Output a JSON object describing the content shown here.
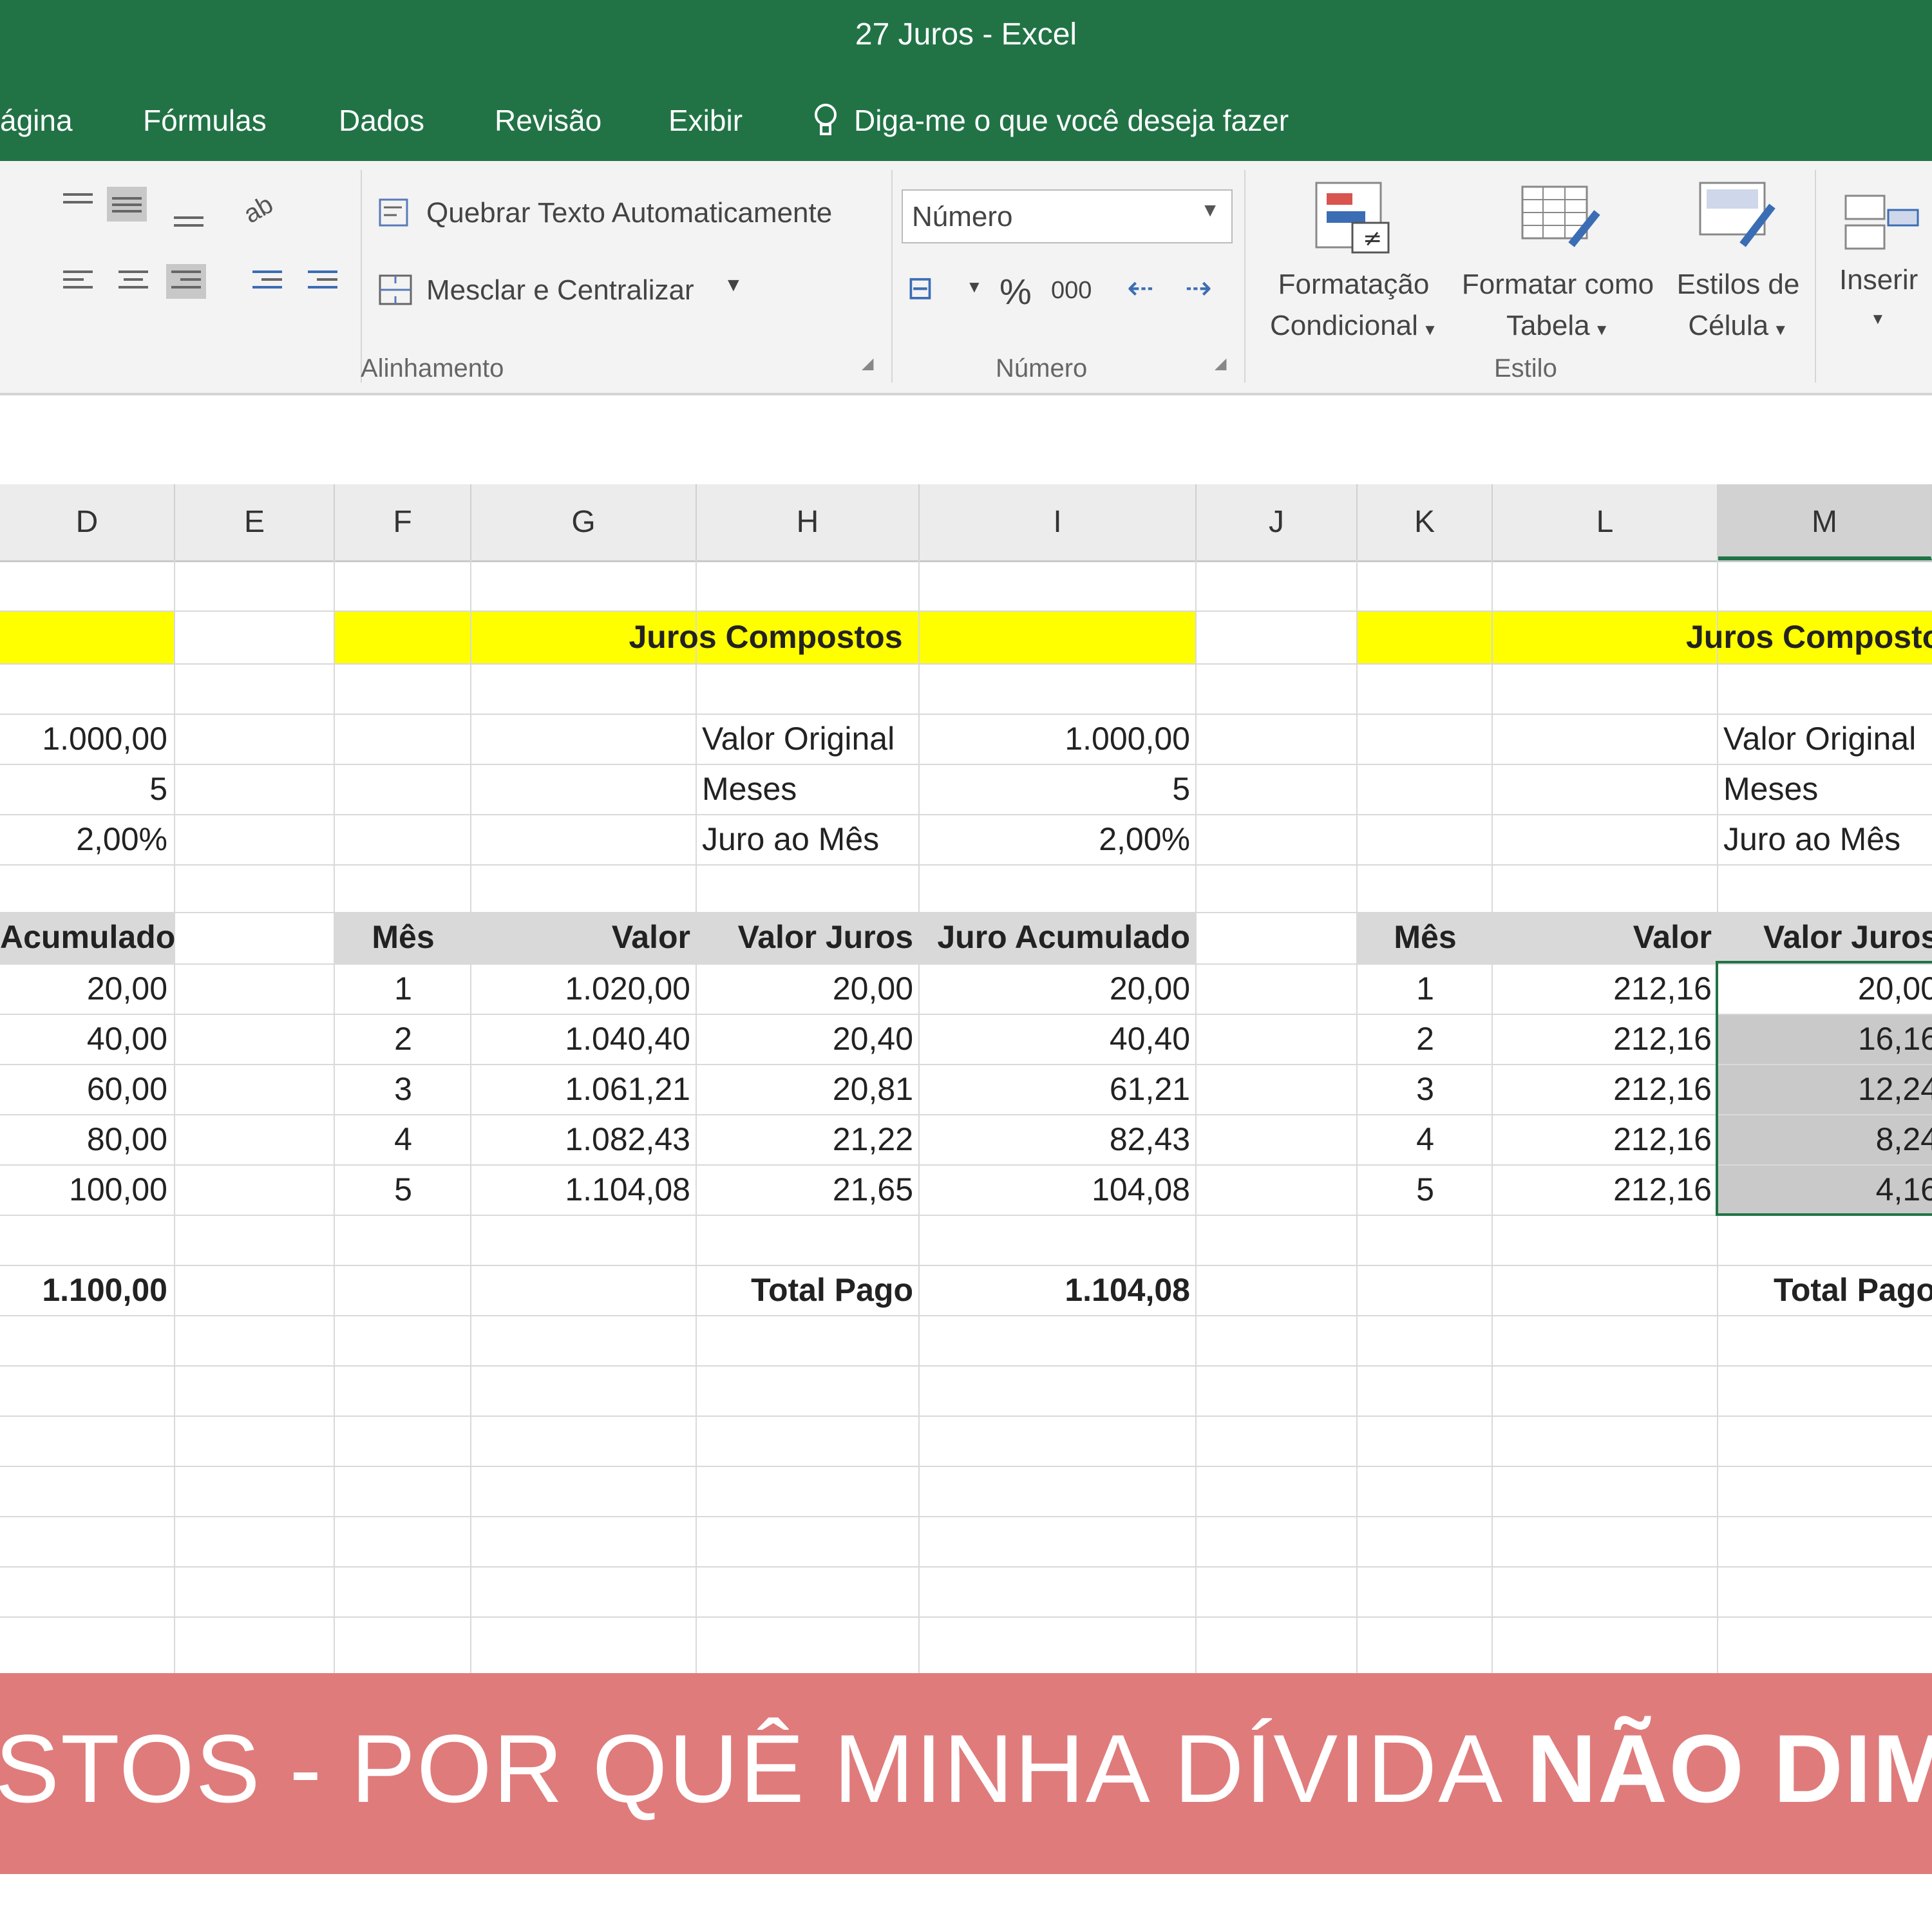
{
  "window": {
    "title": "27 Juros - Excel"
  },
  "menu": {
    "tabs": [
      "ágina",
      "Fórmulas",
      "Dados",
      "Revisão",
      "Exibir"
    ],
    "tell_me": "Diga-me o que você deseja fazer"
  },
  "ribbon": {
    "wrap_text": "Quebrar Texto Automaticamente",
    "merge_center": "Mesclar e Centralizar",
    "alignment_label": "Alinhamento",
    "number_format": "Número",
    "percent_symbol": "%",
    "thousands_symbol": "000",
    "number_label": "Número",
    "cond_format": [
      "Formatação",
      "Condicional"
    ],
    "format_table": [
      "Formatar como",
      "Tabela"
    ],
    "cell_styles": [
      "Estilos de",
      "Célula"
    ],
    "style_label": "Estilo",
    "insert": "Inserir"
  },
  "columns": [
    "D",
    "E",
    "F",
    "G",
    "H",
    "I",
    "J",
    "K",
    "L",
    "M"
  ],
  "sheet": {
    "left": {
      "values": [
        "1.000,00",
        "5",
        "2,00%"
      ],
      "header": "Acumulado",
      "rows": [
        "20,00",
        "40,00",
        "60,00",
        "80,00",
        "100,00"
      ],
      "total": "1.100,00"
    },
    "middle": {
      "title": "Juros Compostos",
      "labels": [
        "Valor Original",
        "Meses",
        "Juro ao Mês"
      ],
      "values": [
        "1.000,00",
        "5",
        "2,00%"
      ],
      "headers": [
        "Mês",
        "Valor",
        "Valor Juros",
        "Juro Acumulado"
      ],
      "rows": [
        [
          "1",
          "1.020,00",
          "20,00",
          "20,00"
        ],
        [
          "2",
          "1.040,40",
          "20,40",
          "40,40"
        ],
        [
          "3",
          "1.061,21",
          "20,81",
          "61,21"
        ],
        [
          "4",
          "1.082,43",
          "21,22",
          "82,43"
        ],
        [
          "5",
          "1.104,08",
          "21,65",
          "104,08"
        ]
      ],
      "total_label": "Total Pago",
      "total": "1.104,08"
    },
    "right": {
      "title": "Juros Compostos",
      "labels": [
        "Valor Original",
        "Meses",
        "Juro ao Mês"
      ],
      "headers": [
        "Mês",
        "Valor",
        "Valor Juros"
      ],
      "rows": [
        [
          "1",
          "212,16",
          "20,00"
        ],
        [
          "2",
          "212,16",
          "16,16"
        ],
        [
          "3",
          "212,16",
          "12,24"
        ],
        [
          "4",
          "212,16",
          "8,24"
        ],
        [
          "5",
          "212,16",
          "4,16"
        ]
      ],
      "total_label": "Total Pago"
    }
  },
  "banner": {
    "text_regular": "STOS - POR QUÊ MINHA DÍVIDA ",
    "text_bold": "NÃO DIMINUI?"
  },
  "colors": {
    "excel_green": "#217346",
    "highlight_yellow": "#ffff00",
    "banner_red": "#e07b7b"
  }
}
